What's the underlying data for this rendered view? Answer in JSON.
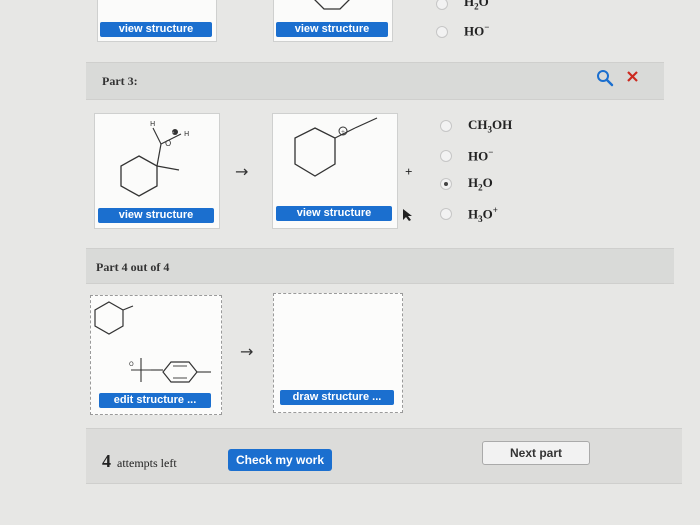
{
  "part2": {
    "buttons": [
      "view structure",
      "view structure"
    ],
    "options": [
      {
        "id": "h2o",
        "label_main": "H",
        "sub": "2",
        "label_rest": "O",
        "sup": "",
        "selected": false
      },
      {
        "id": "ho",
        "label_main": "HO",
        "sub": "",
        "label_rest": "",
        "sup": "−",
        "selected": false
      }
    ]
  },
  "part3": {
    "title": "Part 3:",
    "reactant_button": "view structure",
    "product_button": "view structure",
    "plus": "+",
    "arrow": "→",
    "atom_labels": {
      "h1": "H",
      "h2": "H",
      "o": "O",
      "plus": "+"
    },
    "options": [
      {
        "id": "ch3oh",
        "label_main": "CH",
        "sub": "3",
        "label_rest": "OH",
        "sup": "",
        "selected": false
      },
      {
        "id": "ho",
        "label_main": "HO",
        "sub": "",
        "label_rest": "",
        "sup": "−",
        "selected": false
      },
      {
        "id": "h2o",
        "label_main": "H",
        "sub": "2",
        "label_rest": "O",
        "sup": "",
        "selected": true
      },
      {
        "id": "h3o",
        "label_main": "H",
        "sub": "3",
        "label_rest": "O",
        "sup": "+",
        "selected": false
      }
    ]
  },
  "part4": {
    "title": "Part 4 out of 4",
    "edit_button": "edit structure ...",
    "draw_button": "draw structure ...",
    "arrow": "→",
    "atom_labels": {
      "o": "O"
    }
  },
  "footer": {
    "attempts_count": "4",
    "attempts_label": "attempts left",
    "check_button": "Check my work",
    "next_button": "Next part"
  },
  "colors": {
    "accent": "#1b6fcf",
    "close": "#cc2a1f"
  }
}
